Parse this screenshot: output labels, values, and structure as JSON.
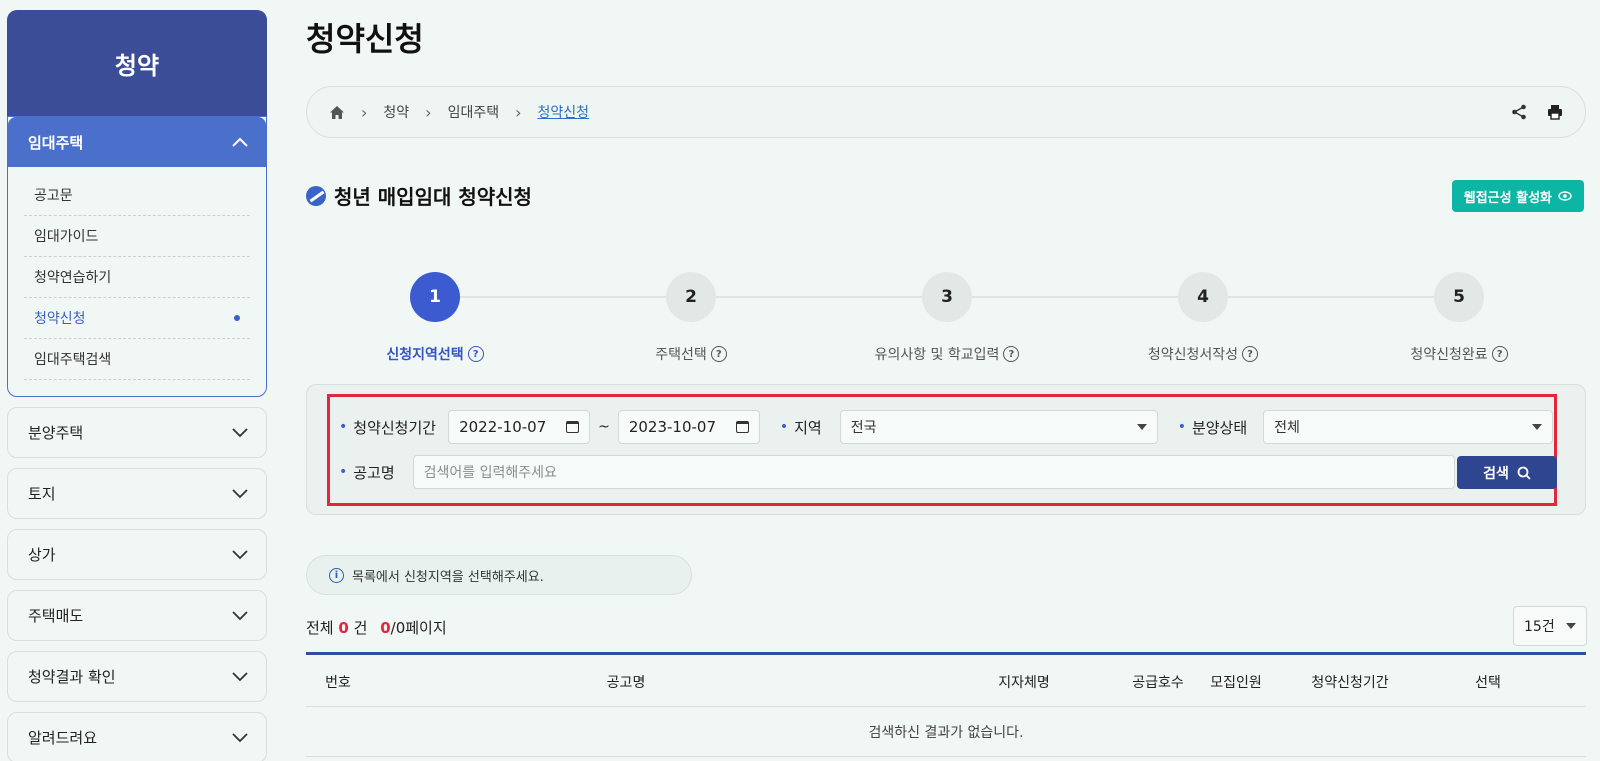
{
  "sidebar": {
    "title": "청약",
    "open_section": {
      "label": "임대주택",
      "items": [
        {
          "label": "공고문"
        },
        {
          "label": "임대가이드"
        },
        {
          "label": "청약연습하기"
        },
        {
          "label": "청약신청"
        },
        {
          "label": "임대주택검색"
        }
      ],
      "active_item": "청약신청"
    },
    "collapsed_sections": [
      {
        "label": "분양주택"
      },
      {
        "label": "토지"
      },
      {
        "label": "상가"
      },
      {
        "label": "주택매도"
      },
      {
        "label": "청약결과 확인"
      },
      {
        "label": "알려드려요"
      }
    ]
  },
  "page": {
    "title": "청약신청",
    "breadcrumb": [
      "청약",
      "임대주택",
      "청약신청"
    ],
    "section_title": "청년 매입임대 청약신청",
    "accessibility_button": "웹접근성 활성화"
  },
  "steps": [
    {
      "number": "1",
      "label": "신청지역선택",
      "active": true
    },
    {
      "number": "2",
      "label": "주택선택"
    },
    {
      "number": "3",
      "label": "유의사항 및 학교입력"
    },
    {
      "number": "4",
      "label": "청약신청서작성"
    },
    {
      "number": "5",
      "label": "청약신청완료"
    }
  ],
  "search": {
    "period_label": "청약신청기간",
    "date_from": "2022-10-07",
    "tilde": "~",
    "date_to": "2023-10-07",
    "region_label": "지역",
    "region_value": "전국",
    "status_label": "분양상태",
    "status_value": "전체",
    "notice_label": "공고명",
    "notice_placeholder": "검색어를 입력해주세요",
    "search_button": "검색"
  },
  "info_message": "목록에서 신청지역을 선택해주세요.",
  "summary": {
    "total_prefix": "전체",
    "total_count": "0",
    "total_unit": "건",
    "page_current": "0",
    "page_suffix": "/0페이지"
  },
  "per_page": "15건",
  "table": {
    "headers": [
      "번호",
      "공고명",
      "지자체명",
      "공급호수",
      "모집인원",
      "청약신청기간",
      "선택"
    ],
    "empty_message": "검색하신 결과가 없습니다."
  },
  "colors": {
    "sidebar_head": "#3a4d96",
    "sidebar_open": "#4a70cc",
    "step_active": "#3d5bd0",
    "accessibility": "#0db5a4",
    "search_button": "#2e4590",
    "highlight_box": "#e3263d"
  }
}
